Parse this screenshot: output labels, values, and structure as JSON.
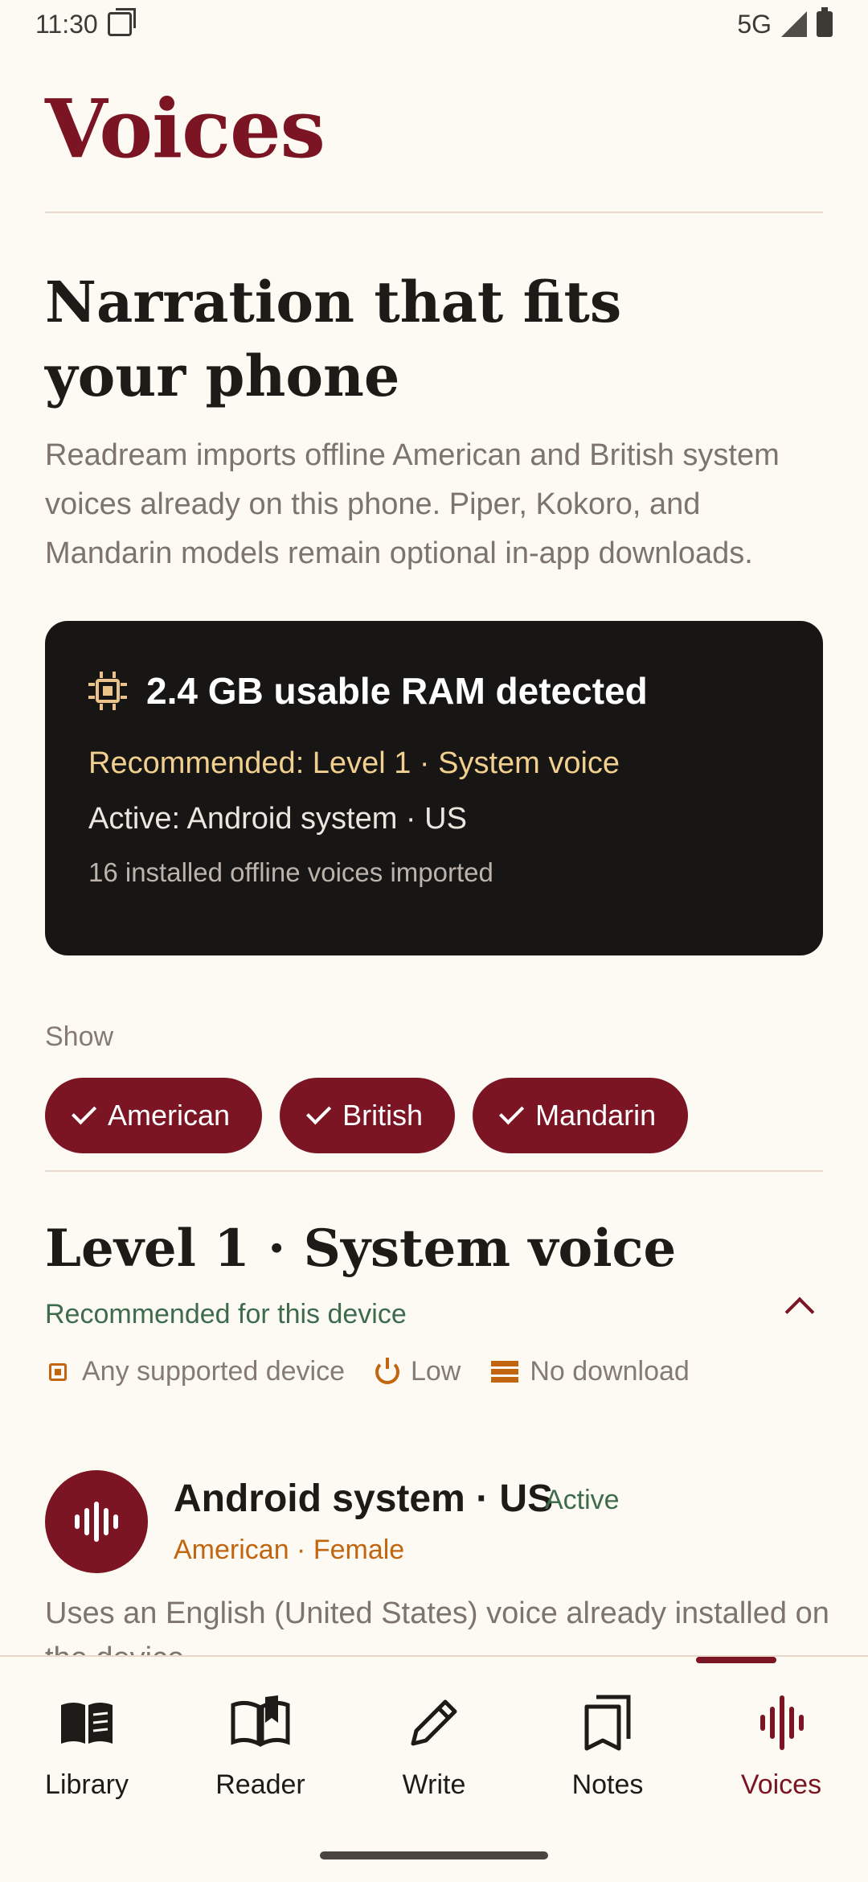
{
  "status_bar": {
    "time": "11:30",
    "network": "5G"
  },
  "page": {
    "title": "Voices"
  },
  "hero": {
    "title": "Narration that fits your phone",
    "description": "Readream imports offline American and British system voices already on this phone. Piper, Kokoro, and Mandarin models remain optional in-app downloads."
  },
  "ram_card": {
    "icon": "chip-icon",
    "title": "2.4 GB usable RAM detected",
    "recommended": "Recommended: Level 1 · System voice",
    "active": "Active: Android system · US",
    "installed": "16 installed offline voices imported",
    "accent_color": "#e9c38a"
  },
  "filter": {
    "label": "Show",
    "chips": [
      {
        "label": "American",
        "selected": true
      },
      {
        "label": "British",
        "selected": true
      },
      {
        "label": "Mandarin",
        "selected": true
      }
    ]
  },
  "level": {
    "title": "Level 1 · System voice",
    "subtitle": "Recommended for this device",
    "meta": [
      {
        "icon": "chip-icon",
        "label": "Any supported device"
      },
      {
        "icon": "power-icon",
        "label": "Low"
      },
      {
        "icon": "storage-icon",
        "label": "No download"
      }
    ]
  },
  "voice": {
    "icon": "waveform-icon",
    "name": "Android system · US",
    "status": "Active",
    "accent": "American · Female",
    "description": "Uses an English (United States) voice already installed on the device."
  },
  "nav": {
    "items": [
      {
        "label": "Library",
        "icon": "library-icon",
        "active": false
      },
      {
        "label": "Reader",
        "icon": "open-book-icon",
        "active": false
      },
      {
        "label": "Write",
        "icon": "pencil-icon",
        "active": false
      },
      {
        "label": "Notes",
        "icon": "notes-icon",
        "active": false
      },
      {
        "label": "Voices",
        "icon": "waveform-icon",
        "active": true
      }
    ]
  },
  "colors": {
    "brand": "#7b1423",
    "background": "#fdfaf4",
    "success": "#3f6b4d",
    "accent": "#c2650f"
  }
}
